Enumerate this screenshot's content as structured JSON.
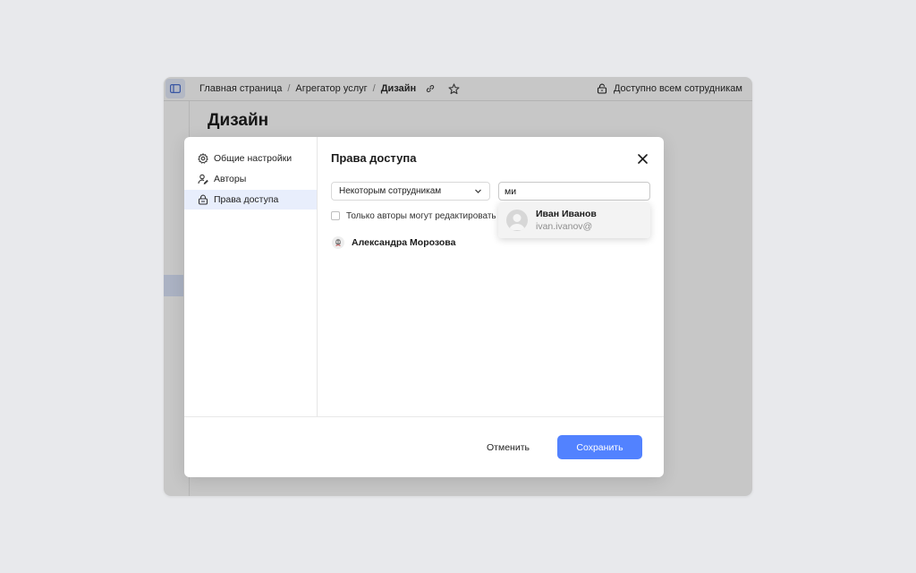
{
  "topbar": {
    "breadcrumb": [
      {
        "label": "Главная страница"
      },
      {
        "label": "Агрегатор услуг"
      },
      {
        "label": "Дизайн"
      }
    ],
    "separator": "/",
    "access_label": "Доступно всем сотрудникам"
  },
  "page": {
    "title": "Дизайн"
  },
  "modal": {
    "nav": [
      {
        "label": "Общие настройки",
        "icon": "gear-icon"
      },
      {
        "label": "Авторы",
        "icon": "authors-icon"
      },
      {
        "label": "Права доступа",
        "icon": "lock-icon"
      }
    ],
    "title": "Права доступа",
    "select_value": "Некоторым сотрудникам",
    "search_value": "ми",
    "checkbox_label": "Только авторы могут редактировать с",
    "person": "Александра Морозова",
    "suggestion": {
      "name": "Иван Иванов",
      "login": "ivan.ivanov@"
    },
    "cancel_label": "Отменить",
    "save_label": "Сохранить"
  },
  "colors": {
    "accent": "#5282ff",
    "active_nav": "#e8eefc",
    "backdrop": "#e8e9ec"
  }
}
